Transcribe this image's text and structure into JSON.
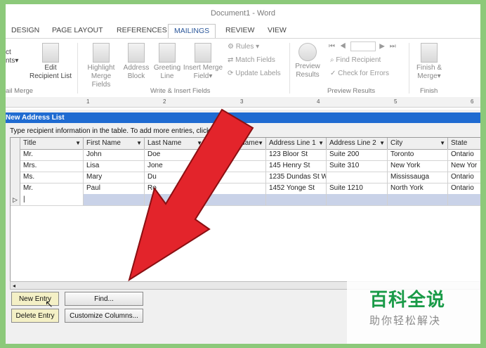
{
  "window": {
    "title": "Document1 - Word"
  },
  "ribbon": {
    "tabs": [
      "DESIGN",
      "PAGE LAYOUT",
      "REFERENCES",
      "MAILINGS",
      "REVIEW",
      "VIEW"
    ],
    "active_tab": "MAILINGS",
    "buttons": {
      "select_recipients_1": "ct",
      "select_recipients_2": "nts",
      "edit_list_1": "Edit",
      "edit_list_2": "Recipient List",
      "highlight_1": "Highlight",
      "highlight_2": "Merge Fields",
      "address_1": "Address",
      "address_2": "Block",
      "greeting_1": "Greeting",
      "greeting_2": "Line",
      "insert_1": "Insert Merge",
      "insert_2": "Field",
      "rules": "Rules",
      "match_fields": "Match Fields",
      "update_labels": "Update Labels",
      "preview_1": "Preview",
      "preview_2": "Results",
      "find_recipient": "Find Recipient",
      "check_errors": "Check for Errors",
      "finish_1": "Finish &",
      "finish_2": "Merge"
    },
    "groups": {
      "mail_merge": "ail Merge",
      "write_insert": "Write & Insert Fields",
      "preview_results": "Preview Results",
      "finish": "Finish"
    }
  },
  "ruler": {
    "marks": [
      "1",
      "2",
      "3",
      "4",
      "5",
      "6"
    ]
  },
  "dialog": {
    "title": "New Address List",
    "instruction": "Type recipient information in the table.  To add more entries, click New Entry.",
    "columns": [
      "Title",
      "First Name",
      "Last Name",
      "Company Name",
      "Address Line 1",
      "Address Line 2",
      "City",
      "State"
    ],
    "rows": [
      [
        "Mr.",
        "John",
        "Doe",
        "Bel",
        "123 Bloor St",
        "Suite 200",
        "Toronto",
        "Ontario"
      ],
      [
        "Mrs.",
        "Lisa",
        "Jone",
        "",
        "145 Henry St",
        "Suite 310",
        "New York",
        "New Yor"
      ],
      [
        "Ms.",
        "Mary",
        "Du",
        "",
        "1235 Dundas St W",
        "",
        "Mississauga",
        "Ontario"
      ],
      [
        "Mr.",
        "Paul",
        "Ro",
        "",
        "1452 Yonge St",
        "Suite 1210",
        "North York",
        "Ontario"
      ]
    ],
    "new_row_marker": "▷",
    "scroll_left": "◂",
    "buttons": {
      "new_entry": "New Entry",
      "find": "Find...",
      "delete_entry": "Delete Entry",
      "customize_columns": "Customize Columns..."
    }
  },
  "watermark": {
    "line1": "百科全说",
    "line2": "助你轻松解决"
  },
  "colors": {
    "arrow": "#e3242b",
    "title_bar": "#1f6bd1",
    "accent_tab": "#2b579a",
    "page_border": "#8cc97a"
  }
}
